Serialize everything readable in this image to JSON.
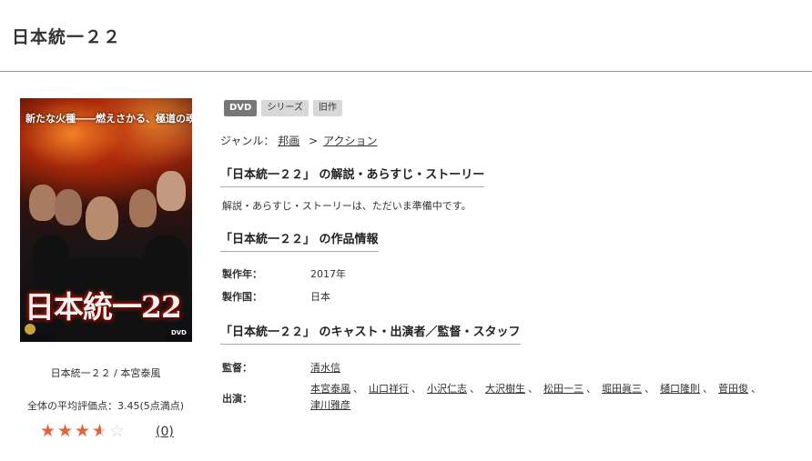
{
  "page": {
    "title": "日本統一２２"
  },
  "poster": {
    "tagline": "新たな火種――燃えさかる、極道の魂",
    "title_art": "日本統一22",
    "dvd_mark": "DVD"
  },
  "caption": "日本統一２２ / 本宮泰風",
  "rating": {
    "text": "全体の平均評価点：3.45(5点満点)",
    "value": 3.45,
    "max": 5,
    "review_count": "(0)"
  },
  "badges": [
    "DVD",
    "シリーズ",
    "旧作"
  ],
  "genre": {
    "label": "ジャンル：",
    "parent": "邦画",
    "separator": ">",
    "child": "アクション"
  },
  "sections": {
    "synopsis_head": "「日本統一２２」 の解説・あらすじ・ストーリー",
    "synopsis_text": "解説・あらすじ・ストーリーは、ただいま準備中です。",
    "info_head": "「日本統一２２」 の作品情報",
    "cast_head": "「日本統一２２」 のキャスト・出演者／監督・スタッフ"
  },
  "info": {
    "year_label": "製作年：",
    "year_value": "2017年",
    "country_label": "製作国：",
    "country_value": "日本"
  },
  "staff": {
    "director_label": "監督：",
    "director": "清水信",
    "cast_label": "出演：",
    "cast": [
      "本宮泰風",
      "山口祥行",
      "小沢仁志",
      "大沢樹生",
      "松田一三",
      "堀田眞三",
      "樋口隆則",
      "菅田俊",
      "津川雅彦"
    ]
  },
  "colors": {
    "star": "#e4623a",
    "badge_dark": "#777777",
    "badge_light": "#d8d8d8"
  }
}
